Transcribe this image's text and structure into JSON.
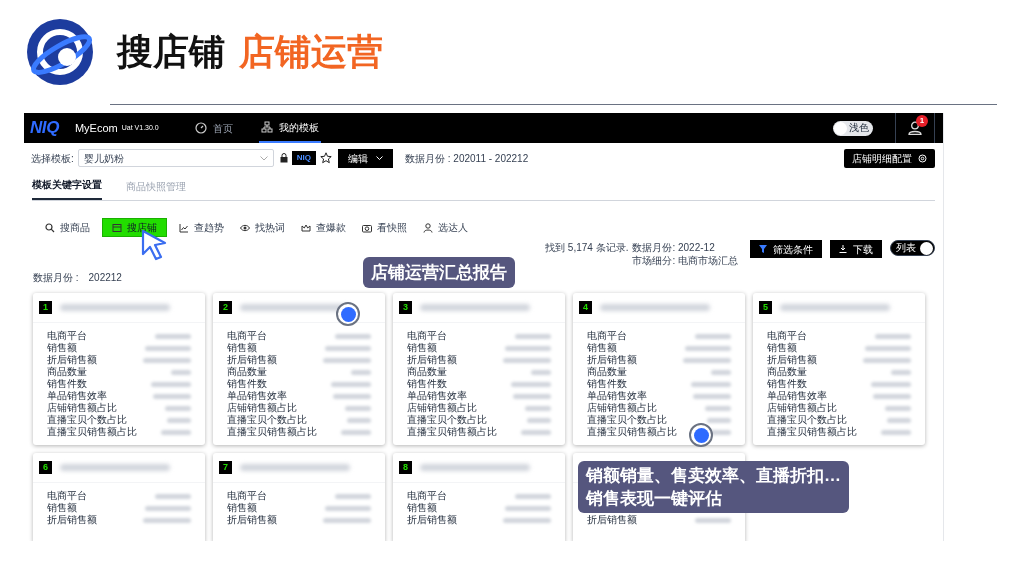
{
  "slide": {
    "title": [
      {
        "text": "搜店铺",
        "kind": "plain"
      },
      {
        "text": "店铺运营",
        "kind": "accent"
      }
    ]
  },
  "app": {
    "logo": "NIQ",
    "product": "MyEcom",
    "version": "Uat V1.30.0",
    "nav": [
      {
        "label": "首页",
        "selected": false
      },
      {
        "label": "我的模板",
        "selected": true
      }
    ],
    "theme_toggle": {
      "label": "浅色",
      "on": false
    },
    "notification_count": "1",
    "template": {
      "label": "选择模板:",
      "value": "婴儿奶粉",
      "brand": "NIQ",
      "edit": "编辑",
      "data_months": "数据月份 : 202011 - 202212"
    },
    "config_button": "店铺明细配置",
    "tabs": [
      {
        "label": "模板关键字设置",
        "selected": true
      },
      {
        "label": "商品快照管理",
        "selected": false
      }
    ],
    "tools": [
      {
        "label": "搜商品",
        "selected": false
      },
      {
        "label": "搜店铺",
        "selected": true
      },
      {
        "label": "查趋势",
        "selected": false
      },
      {
        "label": "找热词",
        "selected": false
      },
      {
        "label": "查爆款",
        "selected": false
      },
      {
        "label": "看快照",
        "selected": false
      },
      {
        "label": "选达人",
        "selected": false
      }
    ],
    "results": {
      "found": "找到 5,174 条记录.",
      "month": "数据月份: 2022-12",
      "market": "市场细分: 电商市场汇总"
    },
    "filter_button": "筛选条件",
    "download_button": "下载",
    "view_toggle": {
      "label": "列表",
      "on": true
    },
    "data_month": {
      "label": "数据月份 :",
      "value": "202212"
    },
    "cards": [
      {
        "number": "1",
        "rows": [
          "电商平台",
          "销售额",
          "折后销售额",
          "商品数量",
          "销售件数",
          "单品销售效率",
          "店铺销售额占比",
          "直播宝贝个数占比",
          "直播宝贝销售额占比"
        ]
      },
      {
        "number": "2",
        "rows": [
          "电商平台",
          "销售额",
          "折后销售额",
          "商品数量",
          "销售件数",
          "单品销售效率",
          "店铺销售额占比",
          "直播宝贝个数占比",
          "直播宝贝销售额占比"
        ]
      },
      {
        "number": "3",
        "rows": [
          "电商平台",
          "销售额",
          "折后销售额",
          "商品数量",
          "销售件数",
          "单品销售效率",
          "店铺销售额占比",
          "直播宝贝个数占比",
          "直播宝贝销售额占比"
        ]
      },
      {
        "number": "4",
        "rows": [
          "电商平台",
          "销售额",
          "折后销售额",
          "商品数量",
          "销售件数",
          "单品销售效率",
          "店铺销售额占比",
          "直播宝贝个数占比",
          "直播宝贝销售额占比"
        ]
      },
      {
        "number": "5",
        "rows": [
          "电商平台",
          "销售额",
          "折后销售额",
          "商品数量",
          "销售件数",
          "单品销售效率",
          "店铺销售额占比",
          "直播宝贝个数占比",
          "直播宝贝销售额占比"
        ]
      },
      {
        "number": "6",
        "rows": [
          "电商平台",
          "销售额",
          "折后销售额"
        ]
      },
      {
        "number": "7",
        "rows": [
          "电商平台",
          "销售额",
          "折后销售额"
        ]
      },
      {
        "number": "8",
        "rows": [
          "电商平台",
          "销售额",
          "折后销售额"
        ]
      },
      {
        "rows": [
          "折后销售额"
        ]
      }
    ]
  },
  "callouts": [
    {
      "lines": [
        "店铺运营汇总报告"
      ]
    },
    {
      "lines": [
        "销额销量、售卖效率、直播折扣…",
        "销售表现一键评估"
      ]
    }
  ]
}
